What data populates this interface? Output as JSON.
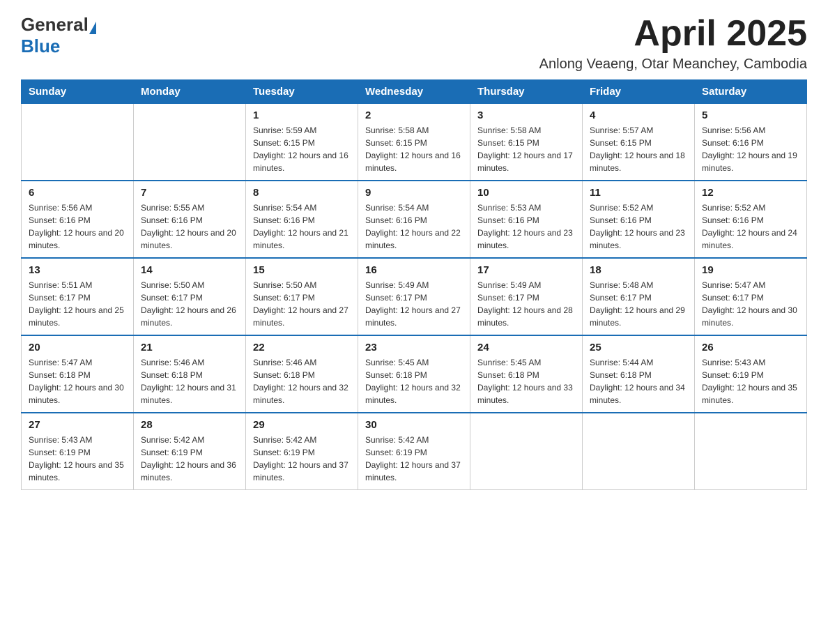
{
  "header": {
    "logo_text_general": "General",
    "logo_text_blue": "Blue",
    "title": "April 2025",
    "subtitle": "Anlong Veaeng, Otar Meanchey, Cambodia"
  },
  "days_of_week": [
    "Sunday",
    "Monday",
    "Tuesday",
    "Wednesday",
    "Thursday",
    "Friday",
    "Saturday"
  ],
  "weeks": [
    [
      {
        "day": "",
        "sunrise": "",
        "sunset": "",
        "daylight": ""
      },
      {
        "day": "",
        "sunrise": "",
        "sunset": "",
        "daylight": ""
      },
      {
        "day": "1",
        "sunrise": "Sunrise: 5:59 AM",
        "sunset": "Sunset: 6:15 PM",
        "daylight": "Daylight: 12 hours and 16 minutes."
      },
      {
        "day": "2",
        "sunrise": "Sunrise: 5:58 AM",
        "sunset": "Sunset: 6:15 PM",
        "daylight": "Daylight: 12 hours and 16 minutes."
      },
      {
        "day": "3",
        "sunrise": "Sunrise: 5:58 AM",
        "sunset": "Sunset: 6:15 PM",
        "daylight": "Daylight: 12 hours and 17 minutes."
      },
      {
        "day": "4",
        "sunrise": "Sunrise: 5:57 AM",
        "sunset": "Sunset: 6:15 PM",
        "daylight": "Daylight: 12 hours and 18 minutes."
      },
      {
        "day": "5",
        "sunrise": "Sunrise: 5:56 AM",
        "sunset": "Sunset: 6:16 PM",
        "daylight": "Daylight: 12 hours and 19 minutes."
      }
    ],
    [
      {
        "day": "6",
        "sunrise": "Sunrise: 5:56 AM",
        "sunset": "Sunset: 6:16 PM",
        "daylight": "Daylight: 12 hours and 20 minutes."
      },
      {
        "day": "7",
        "sunrise": "Sunrise: 5:55 AM",
        "sunset": "Sunset: 6:16 PM",
        "daylight": "Daylight: 12 hours and 20 minutes."
      },
      {
        "day": "8",
        "sunrise": "Sunrise: 5:54 AM",
        "sunset": "Sunset: 6:16 PM",
        "daylight": "Daylight: 12 hours and 21 minutes."
      },
      {
        "day": "9",
        "sunrise": "Sunrise: 5:54 AM",
        "sunset": "Sunset: 6:16 PM",
        "daylight": "Daylight: 12 hours and 22 minutes."
      },
      {
        "day": "10",
        "sunrise": "Sunrise: 5:53 AM",
        "sunset": "Sunset: 6:16 PM",
        "daylight": "Daylight: 12 hours and 23 minutes."
      },
      {
        "day": "11",
        "sunrise": "Sunrise: 5:52 AM",
        "sunset": "Sunset: 6:16 PM",
        "daylight": "Daylight: 12 hours and 23 minutes."
      },
      {
        "day": "12",
        "sunrise": "Sunrise: 5:52 AM",
        "sunset": "Sunset: 6:16 PM",
        "daylight": "Daylight: 12 hours and 24 minutes."
      }
    ],
    [
      {
        "day": "13",
        "sunrise": "Sunrise: 5:51 AM",
        "sunset": "Sunset: 6:17 PM",
        "daylight": "Daylight: 12 hours and 25 minutes."
      },
      {
        "day": "14",
        "sunrise": "Sunrise: 5:50 AM",
        "sunset": "Sunset: 6:17 PM",
        "daylight": "Daylight: 12 hours and 26 minutes."
      },
      {
        "day": "15",
        "sunrise": "Sunrise: 5:50 AM",
        "sunset": "Sunset: 6:17 PM",
        "daylight": "Daylight: 12 hours and 27 minutes."
      },
      {
        "day": "16",
        "sunrise": "Sunrise: 5:49 AM",
        "sunset": "Sunset: 6:17 PM",
        "daylight": "Daylight: 12 hours and 27 minutes."
      },
      {
        "day": "17",
        "sunrise": "Sunrise: 5:49 AM",
        "sunset": "Sunset: 6:17 PM",
        "daylight": "Daylight: 12 hours and 28 minutes."
      },
      {
        "day": "18",
        "sunrise": "Sunrise: 5:48 AM",
        "sunset": "Sunset: 6:17 PM",
        "daylight": "Daylight: 12 hours and 29 minutes."
      },
      {
        "day": "19",
        "sunrise": "Sunrise: 5:47 AM",
        "sunset": "Sunset: 6:17 PM",
        "daylight": "Daylight: 12 hours and 30 minutes."
      }
    ],
    [
      {
        "day": "20",
        "sunrise": "Sunrise: 5:47 AM",
        "sunset": "Sunset: 6:18 PM",
        "daylight": "Daylight: 12 hours and 30 minutes."
      },
      {
        "day": "21",
        "sunrise": "Sunrise: 5:46 AM",
        "sunset": "Sunset: 6:18 PM",
        "daylight": "Daylight: 12 hours and 31 minutes."
      },
      {
        "day": "22",
        "sunrise": "Sunrise: 5:46 AM",
        "sunset": "Sunset: 6:18 PM",
        "daylight": "Daylight: 12 hours and 32 minutes."
      },
      {
        "day": "23",
        "sunrise": "Sunrise: 5:45 AM",
        "sunset": "Sunset: 6:18 PM",
        "daylight": "Daylight: 12 hours and 32 minutes."
      },
      {
        "day": "24",
        "sunrise": "Sunrise: 5:45 AM",
        "sunset": "Sunset: 6:18 PM",
        "daylight": "Daylight: 12 hours and 33 minutes."
      },
      {
        "day": "25",
        "sunrise": "Sunrise: 5:44 AM",
        "sunset": "Sunset: 6:18 PM",
        "daylight": "Daylight: 12 hours and 34 minutes."
      },
      {
        "day": "26",
        "sunrise": "Sunrise: 5:43 AM",
        "sunset": "Sunset: 6:19 PM",
        "daylight": "Daylight: 12 hours and 35 minutes."
      }
    ],
    [
      {
        "day": "27",
        "sunrise": "Sunrise: 5:43 AM",
        "sunset": "Sunset: 6:19 PM",
        "daylight": "Daylight: 12 hours and 35 minutes."
      },
      {
        "day": "28",
        "sunrise": "Sunrise: 5:42 AM",
        "sunset": "Sunset: 6:19 PM",
        "daylight": "Daylight: 12 hours and 36 minutes."
      },
      {
        "day": "29",
        "sunrise": "Sunrise: 5:42 AM",
        "sunset": "Sunset: 6:19 PM",
        "daylight": "Daylight: 12 hours and 37 minutes."
      },
      {
        "day": "30",
        "sunrise": "Sunrise: 5:42 AM",
        "sunset": "Sunset: 6:19 PM",
        "daylight": "Daylight: 12 hours and 37 minutes."
      },
      {
        "day": "",
        "sunrise": "",
        "sunset": "",
        "daylight": ""
      },
      {
        "day": "",
        "sunrise": "",
        "sunset": "",
        "daylight": ""
      },
      {
        "day": "",
        "sunrise": "",
        "sunset": "",
        "daylight": ""
      }
    ]
  ]
}
